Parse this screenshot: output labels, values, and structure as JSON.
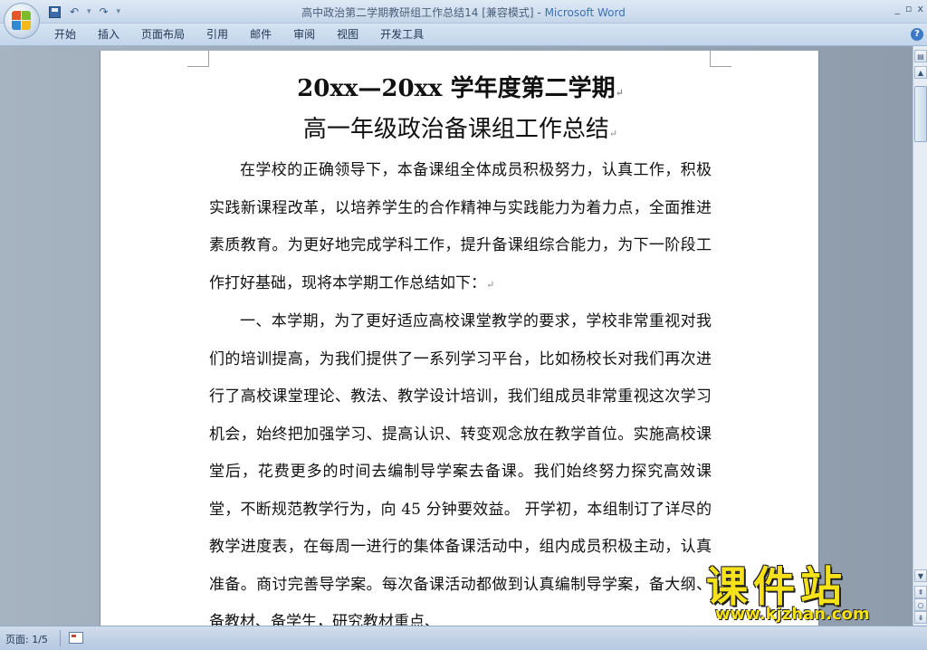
{
  "window": {
    "title": "高中政治第二学期教研组工作总结14 [兼容模式]",
    "title_sep": " - ",
    "app_name": "Microsoft Word",
    "controls": [
      "_",
      "▫",
      "x"
    ]
  },
  "quick_access": {
    "save": "save-icon",
    "undo": "↶",
    "redo": "↷",
    "customize": "▾"
  },
  "ribbon": {
    "tabs": [
      "开始",
      "插入",
      "页面布局",
      "引用",
      "邮件",
      "审阅",
      "视图",
      "开发工具"
    ],
    "help": "?"
  },
  "document": {
    "title_line1": "20xx—20xx 学年度第二学期",
    "title_line2": "高一年级政治备课组工作总结",
    "paragraph_mark": "↵",
    "paragraphs": [
      "在学校的正确领导下，本备课组全体成员积极努力，认真工作，积极实践新课程改革，以培养学生的合作精神与实践能力为着力点，全面推进素质教育。为更好地完成学科工作，提升备课组综合能力，为下一阶段工作打好基础，现将本学期工作总结如下：",
      "一、本学期，为了更好适应高校课堂教学的要求，学校非常重视对我们的培训提高，为我们提供了一系列学习平台，比如杨校长对我们再次进行了高校课堂理论、教法、教学设计培训，我们组成员非常重视这次学习机会，始终把加强学习、提高认识、转变观念放在教学首位。实施高校课堂后，花费更多的时间去编制导学案去备课。我们始终努力探究高效课堂，不断规范教学行为，向 45 分钟要效益。 开学初，本组制订了详尽的教学进度表，在每周一进行的集体备课活动中，组内成员积极主动，认真准备。商讨完善导学案。每次备课活动都做到认真编制导学案，备大纲、备教材、备学生，研究教材重点、"
    ]
  },
  "statusbar": {
    "page": "页面: 1/5"
  },
  "watermark": {
    "title": "课件站",
    "url": "www.kjzhan.com"
  }
}
